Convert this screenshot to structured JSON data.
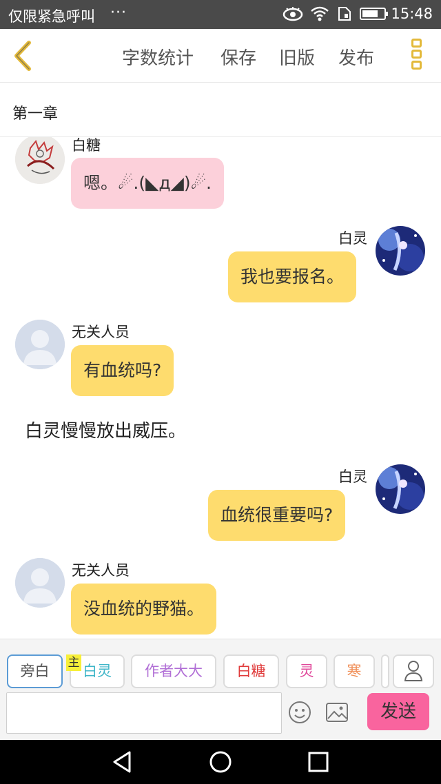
{
  "status_bar": {
    "carrier": "仅限紧急呼叫",
    "more": "···",
    "time": "15:48"
  },
  "navbar": {
    "actions": [
      "字数统计",
      "保存",
      "旧版",
      "发布"
    ]
  },
  "chapter": {
    "title": "第一章"
  },
  "messages": [
    {
      "side": "left",
      "sender": "白糖",
      "text": "嗯。☄.(◣д◢)☄.",
      "color": "pink"
    },
    {
      "side": "right",
      "sender": "白灵",
      "text": "我也要报名。",
      "color": "yellow"
    },
    {
      "side": "left",
      "sender": "无关人员",
      "text": "有血统吗?",
      "color": "yellow"
    },
    {
      "type": "narration",
      "text": "白灵慢慢放出威压。"
    },
    {
      "side": "right",
      "sender": "白灵",
      "text": "血统很重要吗?",
      "color": "yellow"
    },
    {
      "side": "left",
      "sender": "无关人员",
      "text": "没血统的野猫。",
      "color": "yellow"
    }
  ],
  "roles": [
    {
      "label": "旁白",
      "color": "#555555"
    },
    {
      "label": "白灵",
      "color": "#3fb6c8"
    },
    {
      "label": "作者大大",
      "color": "#b16fd6"
    },
    {
      "label": "白糖",
      "color": "#e03a3a"
    },
    {
      "label": "灵",
      "color": "#e0489a"
    },
    {
      "label": "寒",
      "color": "#f0905a"
    }
  ],
  "main_tag": "主",
  "composer": {
    "value": "",
    "placeholder": "",
    "send_label": "发送"
  },
  "colors": {
    "accent": "#e3b93a",
    "send": "#f9649e",
    "bubble_yellow": "#fedc6e",
    "bubble_pink": "#fcd0da"
  }
}
